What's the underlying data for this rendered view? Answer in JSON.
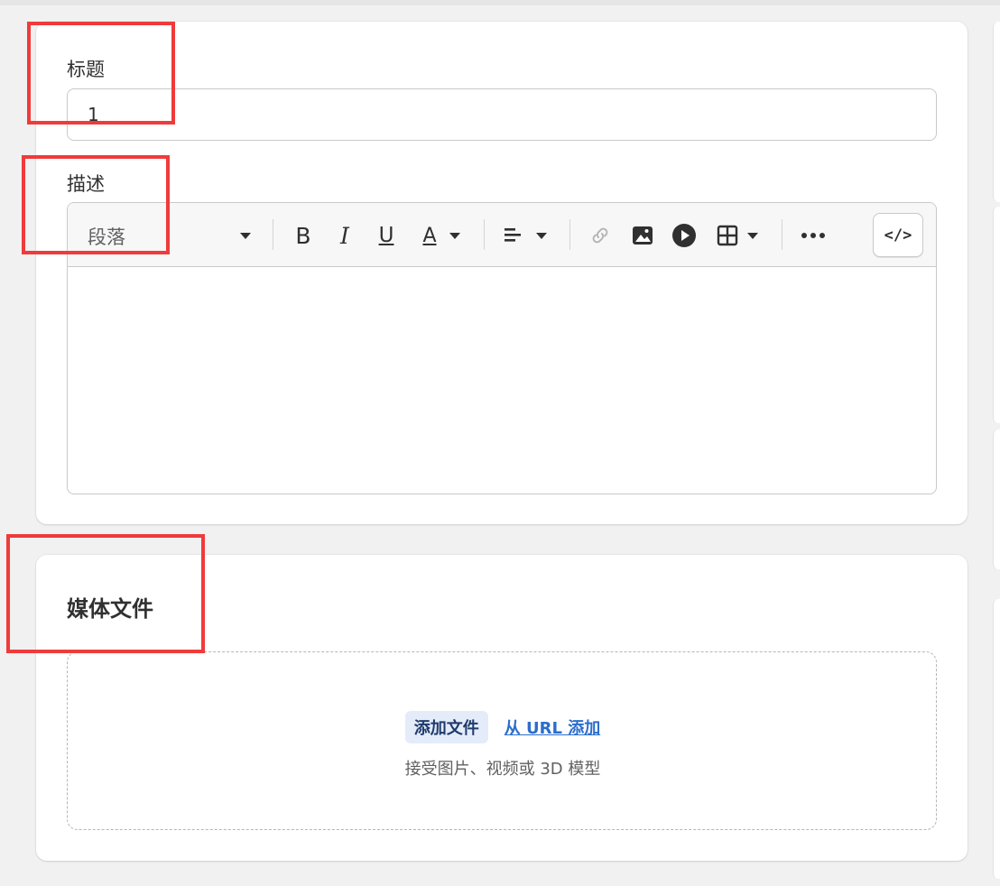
{
  "product_form": {
    "title_label": "标题",
    "title_value": "1",
    "description_label": "描述",
    "toolbar": {
      "paragraph_select": "段落",
      "bold": "B",
      "italic": "I",
      "underline": "U",
      "text_color": "A",
      "code_view": "</>"
    }
  },
  "media": {
    "heading": "媒体文件",
    "add_file_button": "添加文件",
    "add_from_url_link": "从 URL 添加",
    "hint": "接受图片、视频或 3D 模型"
  },
  "colors": {
    "highlight_box": "#ef3b3b",
    "link": "#2c6ecb",
    "add_button_bg": "#e4ecfa"
  }
}
